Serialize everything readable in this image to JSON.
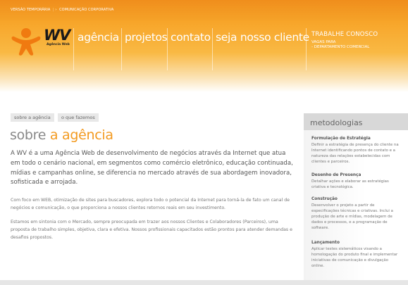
{
  "topbar": {
    "version": "VERSÃO TEMPORÁRIA",
    "separator": "| »",
    "tagline": "COMUNICAÇÃO CORPORATIVA"
  },
  "logo": {
    "mark": "WV",
    "subtitle": "Agência Web"
  },
  "nav": {
    "items": [
      "agência",
      "projetos",
      "contato",
      "seja nosso cliente"
    ],
    "right_title": "TRABALHE CONOSCO",
    "right_links": [
      "VAGAS PARA",
      "- DEPARTAMENTO COMERCIAL"
    ]
  },
  "tabs": [
    "sobre a agência",
    "o que fazemos"
  ],
  "page_title": {
    "lead": "sobre",
    "accent": "a agência"
  },
  "intro": "A WV é a uma Agência Web de desenvolvimento de negócios através da Internet que atua em todo o cenário nacional, em segmentos como comércio eletrônico, educação continuada, mídias e campanhas online, se diferencia no mercado através de sua abordagem inovadora, sofisticada e arrojada.",
  "paragraphs": [
    "Com foco em WEB, otimização de sites para buscadores, explora todo o potencial da Internet para torná-la de fato um canal de negócios e comunicação, o que proporciona a nossos clientes retornos reais em seu investimento.",
    "Estamos em sintonia com o Mercado, sempre preocupada em trazer aos nossos Clientes e Colaboradores (Parceiros), uma proposta de trabalho simples, objetiva, clara e efetiva. Nossos profissionais capacitados estão prontos para atender demandas e desafios propostos."
  ],
  "sidebar": {
    "title": "metodologias",
    "blocks": [
      {
        "title": "Formulação de Estratégia",
        "text": "Definir a estratégia de presença do cliente na Internet identificando pontos de contato e a natureza das relações estabelecidas com clientes e parceiros."
      },
      {
        "title": "Desenho de Presença",
        "text": "Detalhar ações e elaborar as estratégias criativa e tecnológica."
      },
      {
        "title": "Construção",
        "text": "Desenvolver o projeto a partir de especificações técnicas e criativas. Inclui a produção de arte e mídias, modelagem de dados e processos, e a programação de software."
      },
      {
        "title": "Lançamento",
        "text": "Aplicar testes sistemáticos visando a homologação do produto final e implementar iniciativas de comunicação e divulgação online."
      }
    ]
  },
  "colors": {
    "brand_orange": "#f39a1f",
    "header_orange": "#f7a428",
    "sidebar_head": "#d8d8d8"
  },
  "icons": {
    "logo_mascot": "orange-figure-mascot"
  }
}
